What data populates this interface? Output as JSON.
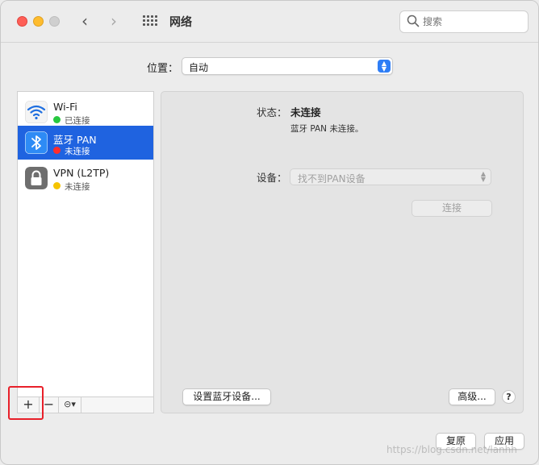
{
  "window": {
    "title": "网络"
  },
  "search": {
    "placeholder": "搜索"
  },
  "location": {
    "label": "位置：",
    "value": "自动"
  },
  "services": [
    {
      "name": "Wi-Fi",
      "status": "已连接",
      "status_color": "#28c840",
      "icon": "wifi-icon",
      "selected": false
    },
    {
      "name": "蓝牙 PAN",
      "status": "未连接",
      "status_color": "#ff2d2d",
      "icon": "bluetooth-icon",
      "selected": true
    },
    {
      "name": "VPN (L2TP)",
      "status": "未连接",
      "status_color": "#f5c400",
      "icon": "lock-icon",
      "selected": false
    }
  ],
  "sidebar_tools": {
    "add": "+",
    "remove": "−",
    "action": "⊝▾"
  },
  "detail": {
    "status_label": "状态：",
    "status_value": "未连接",
    "status_desc": "蓝牙 PAN 未连接。",
    "device_label": "设备：",
    "device_value": "找不到PAN设备",
    "connect_label": "连接",
    "setup_label": "设置蓝牙设备...",
    "advanced_label": "高级...",
    "help_label": "?"
  },
  "footer": {
    "revert_label": "复原",
    "apply_label": "应用"
  },
  "watermark": "https://blog.csdn.net/lanhh"
}
